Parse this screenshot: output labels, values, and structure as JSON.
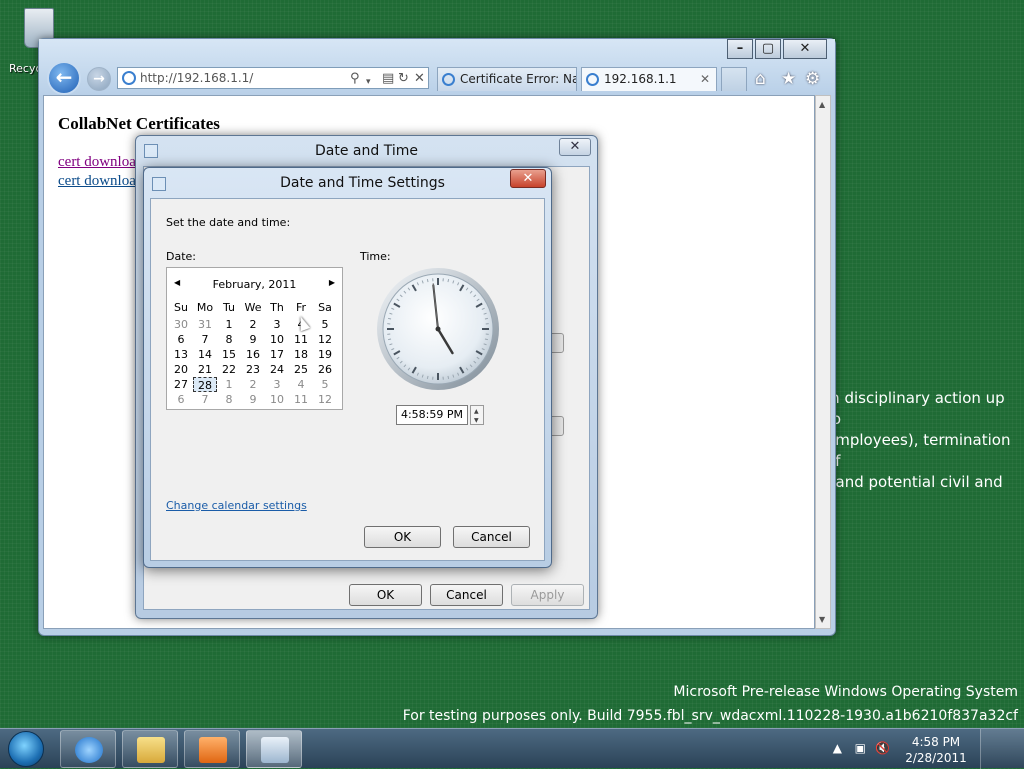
{
  "desktop": {
    "recycle_bin_label": "Recyc",
    "legal_text": [
      "in disciplinary action up to",
      "employees), termination of",
      ", and potential civil and"
    ],
    "watermark": [
      "Microsoft Pre-release Windows Operating System",
      "For testing purposes only. Build 7955.fbl_srv_wdacxml.110228-1930.a1b6210f837a32cf"
    ]
  },
  "browser": {
    "address": "http://192.168.1.1/",
    "tabs": [
      {
        "label": "Certificate Error: Na..."
      },
      {
        "label": "192.168.1.1"
      }
    ],
    "page_title": "CollabNet Certificates",
    "links": [
      "cert download",
      "cert download"
    ]
  },
  "date_time_dialog": {
    "title": "Date and Time",
    "buttons": {
      "ok": "OK",
      "cancel": "Cancel",
      "apply": "Apply"
    }
  },
  "settings_dialog": {
    "title": "Date and Time Settings",
    "instruction": "Set the date and time:",
    "date_label": "Date:",
    "time_label": "Time:",
    "calendar": {
      "month": "February, 2011",
      "weekdays": [
        "Su",
        "Mo",
        "Tu",
        "We",
        "Th",
        "Fr",
        "Sa"
      ],
      "weeks": [
        [
          "30",
          "31",
          "1",
          "2",
          "3",
          "4",
          "5"
        ],
        [
          "6",
          "7",
          "8",
          "9",
          "10",
          "11",
          "12"
        ],
        [
          "13",
          "14",
          "15",
          "16",
          "17",
          "18",
          "19"
        ],
        [
          "20",
          "21",
          "22",
          "23",
          "24",
          "25",
          "26"
        ],
        [
          "27",
          "28",
          "1",
          "2",
          "3",
          "4",
          "5"
        ],
        [
          "6",
          "7",
          "8",
          "9",
          "10",
          "11",
          "12"
        ]
      ],
      "selected": "28"
    },
    "time_value": "4:58:59 PM",
    "clock": {
      "hour": 4,
      "minute": 58,
      "second": 59
    },
    "calendar_link": "Change calendar settings",
    "buttons": {
      "ok": "OK",
      "cancel": "Cancel"
    }
  },
  "taskbar": {
    "time": "4:58 PM",
    "date": "2/28/2011"
  }
}
